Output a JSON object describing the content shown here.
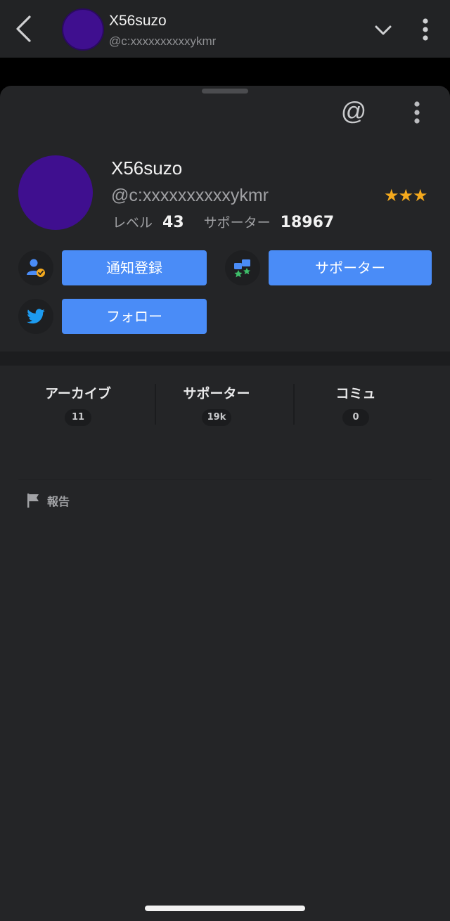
{
  "header": {
    "name": "X56suzo",
    "handle": "@c:xxxxxxxxxxykmr"
  },
  "profile": {
    "at_symbol": "@",
    "name": "X56suzo",
    "handle": "@c:xxxxxxxxxxykmr",
    "stars": "★★★",
    "level_label": "レベル",
    "level_value": "43",
    "supporter_label": "サポーター",
    "supporter_value": "18967"
  },
  "actions": {
    "subscribe_label": "通知登録",
    "supporter_label": "サポーター",
    "follow_label": "フォロー"
  },
  "tabs": [
    {
      "label": "アーカイブ",
      "count": "11"
    },
    {
      "label": "サポーター",
      "count": "19k"
    },
    {
      "label": "コミュ",
      "count": "0"
    }
  ],
  "report": {
    "label": "報告"
  },
  "colors": {
    "background": "#242527",
    "accent": "#4a8cf7",
    "avatar": "#3f0f8f",
    "star": "#f4a91d",
    "twitter": "#1d9bf0"
  },
  "icons": [
    "back-icon",
    "chevron-down-icon",
    "more-vertical-icon",
    "at-icon",
    "user-check-icon",
    "supporter-icon",
    "twitter-icon",
    "flag-icon"
  ]
}
